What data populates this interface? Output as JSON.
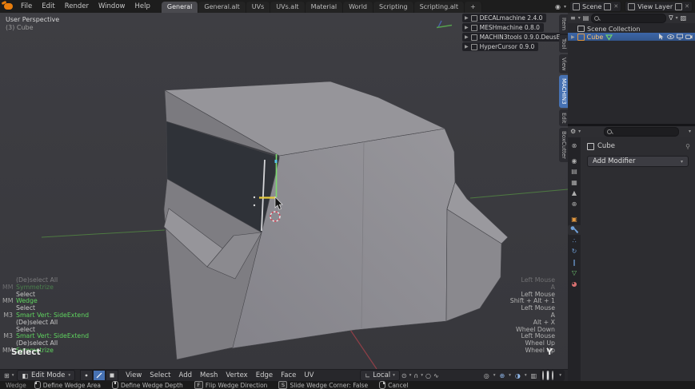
{
  "topbar": {
    "menus": [
      {
        "label": "File"
      },
      {
        "label": "Edit"
      },
      {
        "label": "Render"
      },
      {
        "label": "Window"
      },
      {
        "label": "Help"
      }
    ],
    "workspaces": [
      {
        "label": "General",
        "active": true
      },
      {
        "label": "General.alt",
        "active": false
      },
      {
        "label": "UVs",
        "active": false
      },
      {
        "label": "UVs.alt",
        "active": false
      },
      {
        "label": "Material",
        "active": false
      },
      {
        "label": "World",
        "active": false
      },
      {
        "label": "Scripting",
        "active": false
      },
      {
        "label": "Scripting.alt",
        "active": false
      },
      {
        "label": "+",
        "active": false
      }
    ],
    "scene_label": "Scene",
    "view_layer_label": "View Layer"
  },
  "viewport": {
    "view_label": "User Perspective",
    "object_label": "(3) Cube",
    "addon_panels": [
      {
        "label": "DECALmachine 2.4.0",
        "icons": 4
      },
      {
        "label": "MESHmachine 0.8.0",
        "icons": 1
      },
      {
        "label": "MACHIN3tools 0.9.0.DeusEx",
        "icons": 0
      },
      {
        "label": "HyperCursor 0.9.0",
        "icons": 0
      }
    ],
    "sidebar_tabs": [
      {
        "label": "Item",
        "active": false
      },
      {
        "label": "Tool",
        "active": false
      },
      {
        "label": "View",
        "active": false
      },
      {
        "label": "MACHIN3",
        "active": true
      },
      {
        "label": "Edit",
        "active": false
      },
      {
        "label": "BoxCutter",
        "active": false
      }
    ],
    "history": [
      {
        "prefix": "",
        "label": "(De)select All",
        "green": false,
        "faded": true
      },
      {
        "prefix": "MM",
        "label": "Symmetrize",
        "green": true,
        "faded": true
      },
      {
        "prefix": "",
        "label": "Select",
        "green": false,
        "faded": false
      },
      {
        "prefix": "MM",
        "label": "Wedge",
        "green": true,
        "faded": false
      },
      {
        "prefix": "",
        "label": "Select",
        "green": false,
        "faded": false
      },
      {
        "prefix": "M3",
        "label": "Smart Vert: SideExtend",
        "green": true,
        "faded": false
      },
      {
        "prefix": "",
        "label": "(De)select All",
        "green": false,
        "faded": false
      },
      {
        "prefix": "",
        "label": "Select",
        "green": false,
        "faded": false
      },
      {
        "prefix": "M3",
        "label": "Smart Vert: SideExtend",
        "green": true,
        "faded": false
      },
      {
        "prefix": "",
        "label": "(De)select All",
        "green": false,
        "faded": false
      },
      {
        "prefix": "MM",
        "label": "Symmetrize",
        "green": true,
        "faded": false
      }
    ],
    "history_current": "Select",
    "key_history": [
      {
        "label": "Left Mouse",
        "faded": true
      },
      {
        "label": "A",
        "faded": true
      },
      {
        "label": "Left Mouse",
        "faded": false
      },
      {
        "label": "Shift + Alt + 1",
        "faded": false
      },
      {
        "label": "Left Mouse",
        "faded": false
      },
      {
        "label": "A",
        "faded": false
      },
      {
        "label": "Alt + X",
        "faded": false
      },
      {
        "label": "Wheel Down",
        "faded": false
      },
      {
        "label": "Left Mouse",
        "faded": false
      },
      {
        "label": "Wheel Up",
        "faded": false
      },
      {
        "label": "Wheel Up",
        "faded": false
      }
    ],
    "key_current": "Y"
  },
  "viewport_header": {
    "mode_label": "Edit Mode",
    "menus": [
      {
        "label": "View"
      },
      {
        "label": "Select"
      },
      {
        "label": "Add"
      },
      {
        "label": "Mesh"
      },
      {
        "label": "Vertex"
      },
      {
        "label": "Edge"
      },
      {
        "label": "Face"
      },
      {
        "label": "UV"
      }
    ],
    "orientation_label": "Local"
  },
  "outliner": {
    "collection_label": "Scene Collection",
    "object_label": "Cube"
  },
  "properties": {
    "breadcrumb_label": "Cube",
    "add_modifier_label": "Add Modifier"
  },
  "statusbar": {
    "tool_label": "Wedge",
    "hints": [
      {
        "kind": "mouse-l",
        "key": "",
        "label": "Define Wedge Area"
      },
      {
        "kind": "mouse-m",
        "key": "",
        "label": "Define Wedge Depth"
      },
      {
        "kind": "key",
        "key": "F",
        "label": "Flip Wedge Direction"
      },
      {
        "kind": "key",
        "key": "S",
        "label": "Slide Wedge Corner: False"
      },
      {
        "kind": "mouse-r",
        "key": "",
        "label": "Cancel"
      }
    ]
  },
  "colors": {
    "accent_blue": "#4772b3",
    "history_green": "#5fd45f",
    "selected_edge_green": "#7ddc6f",
    "wedge_yellow": "#e6cc3e",
    "cursor_red": "#d8465a",
    "axis_green": "#4e7a42",
    "axis_red": "#8f3f47",
    "object_orange": "#e2973f"
  }
}
